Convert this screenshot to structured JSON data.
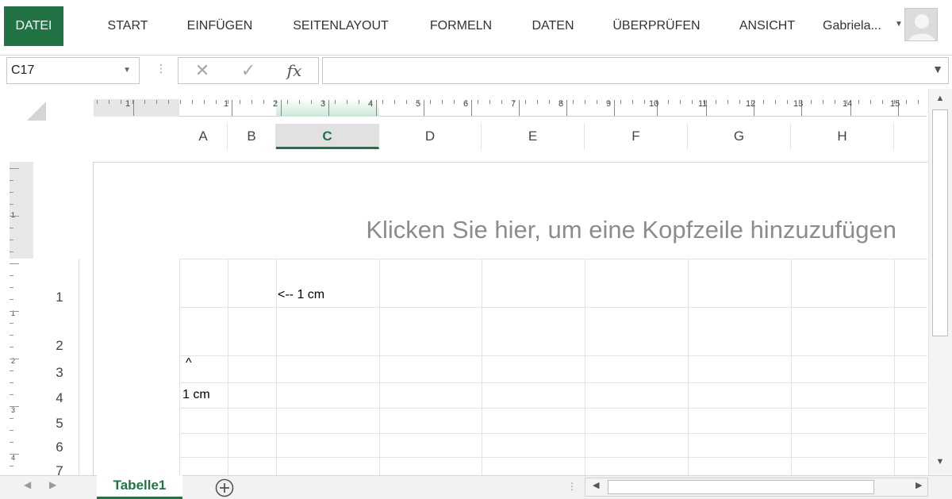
{
  "ribbon": {
    "tabs": [
      "DATEI",
      "START",
      "EINFÜGEN",
      "SEITENLAYOUT",
      "FORMELN",
      "DATEN",
      "ÜBERPRÜFEN",
      "ANSICHT"
    ],
    "user_name": "Gabriela...",
    "accent_color": "#217346"
  },
  "formula_bar": {
    "name_box": "C17",
    "cancel_symbol": "✕",
    "confirm_symbol": "✓",
    "fx_symbol": "fx",
    "formula": ""
  },
  "ruler": {
    "labels": [
      "1",
      "1",
      "2",
      "3",
      "4",
      "5",
      "6",
      "7",
      "8",
      "9",
      "10",
      "11",
      "12",
      "13",
      "14",
      "15"
    ]
  },
  "vertical_ruler": {
    "labels": [
      "1",
      "1",
      "2",
      "3",
      "4"
    ]
  },
  "columns": [
    "A",
    "B",
    "C",
    "D",
    "E",
    "F",
    "G",
    "H"
  ],
  "selected_column": "C",
  "rows": [
    "1",
    "2",
    "3",
    "4",
    "5",
    "6",
    "7"
  ],
  "header_placeholder": "Klicken Sie hier, um eine Kopfzeile hinzuzufügen",
  "cells": {
    "C1": "<-- 1 cm",
    "A3": "^",
    "A4": "1 cm"
  },
  "sheet_tabs": {
    "active": "Tabelle1",
    "add_symbol": "+"
  }
}
